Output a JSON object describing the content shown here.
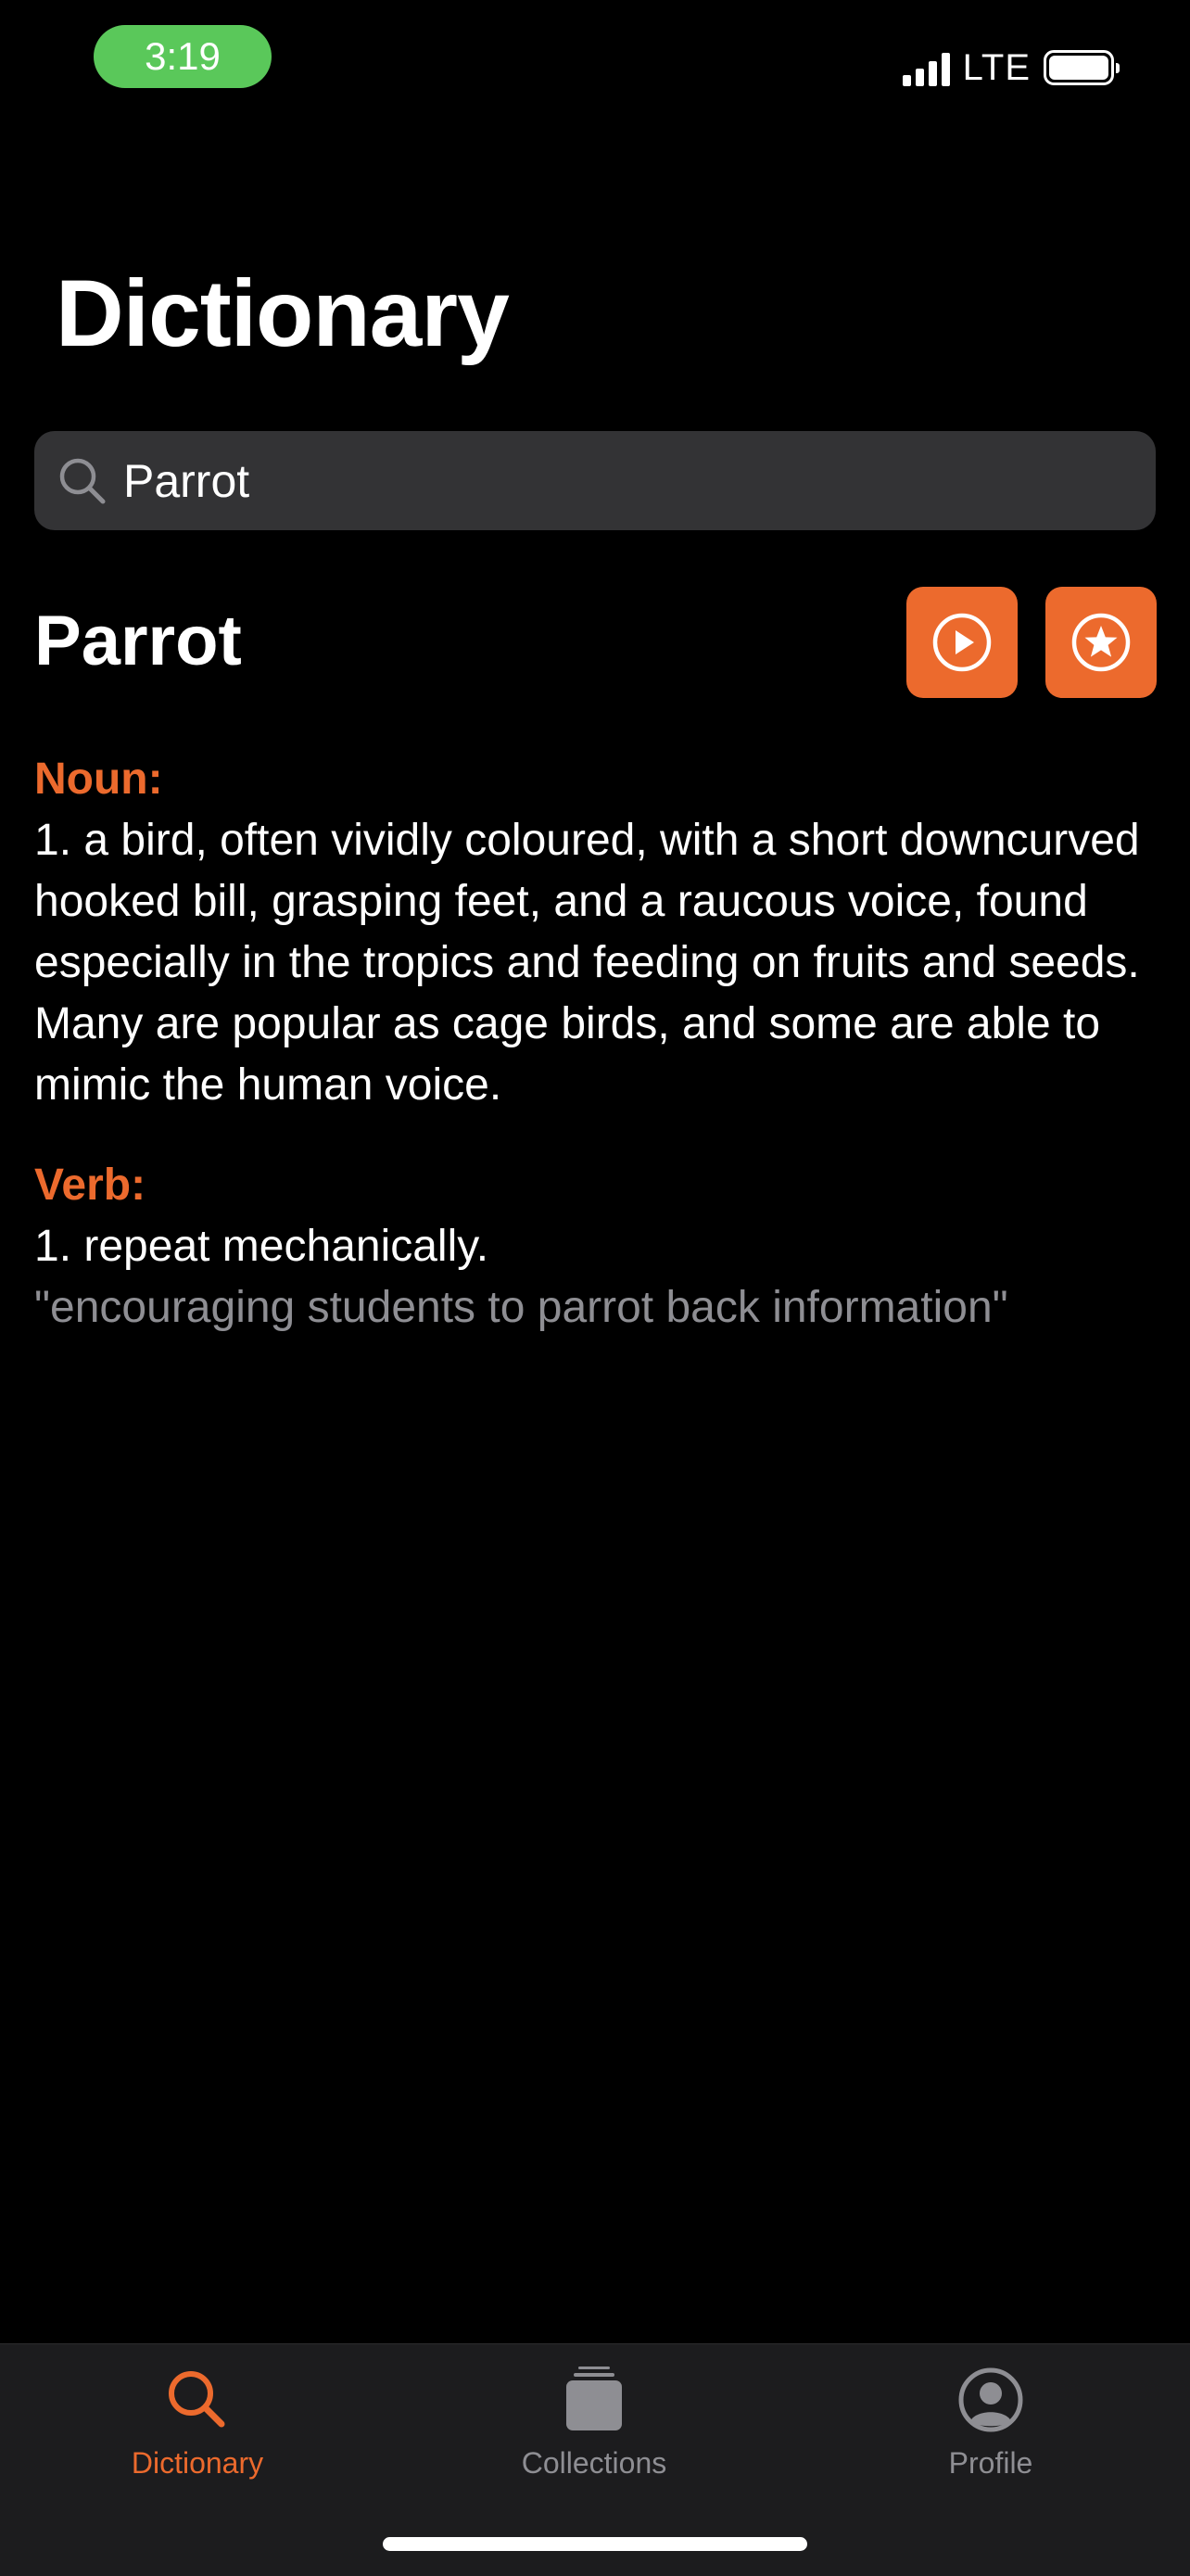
{
  "status_bar": {
    "time": "3:19",
    "network": "LTE"
  },
  "page_title": "Dictionary",
  "search": {
    "value": "Parrot",
    "icon": "search-icon"
  },
  "entry": {
    "word": "Parrot",
    "actions": [
      {
        "name": "play-pronunciation-button",
        "icon": "play-circle-icon"
      },
      {
        "name": "favorite-button",
        "icon": "star-circle-icon"
      }
    ],
    "noun": {
      "label": "Noun:",
      "definition": "1. a bird, often vividly coloured, with a short downcurved hooked bill, grasping feet, and a raucous voice, found especially in the tropics and feeding on fruits and seeds. Many are popular as cage birds, and some are able to mimic the human voice."
    },
    "verb": {
      "label": "Verb:",
      "definition": "1. repeat mechanically.",
      "example": "\"encouraging students to parrot back information\""
    }
  },
  "tab_bar": {
    "tabs": [
      {
        "label": "Dictionary",
        "icon": "search-icon",
        "active": true
      },
      {
        "label": "Collections",
        "icon": "collections-stack-icon",
        "active": false
      },
      {
        "label": "Profile",
        "icon": "person-circle-icon",
        "active": false
      }
    ]
  },
  "colors": {
    "accent": "#ec6a2d",
    "background": "#000000",
    "search_background": "#333335",
    "tab_bar_background": "#1c1c1e",
    "inactive": "#8e8e93",
    "time_pill": "#5ac85a"
  }
}
